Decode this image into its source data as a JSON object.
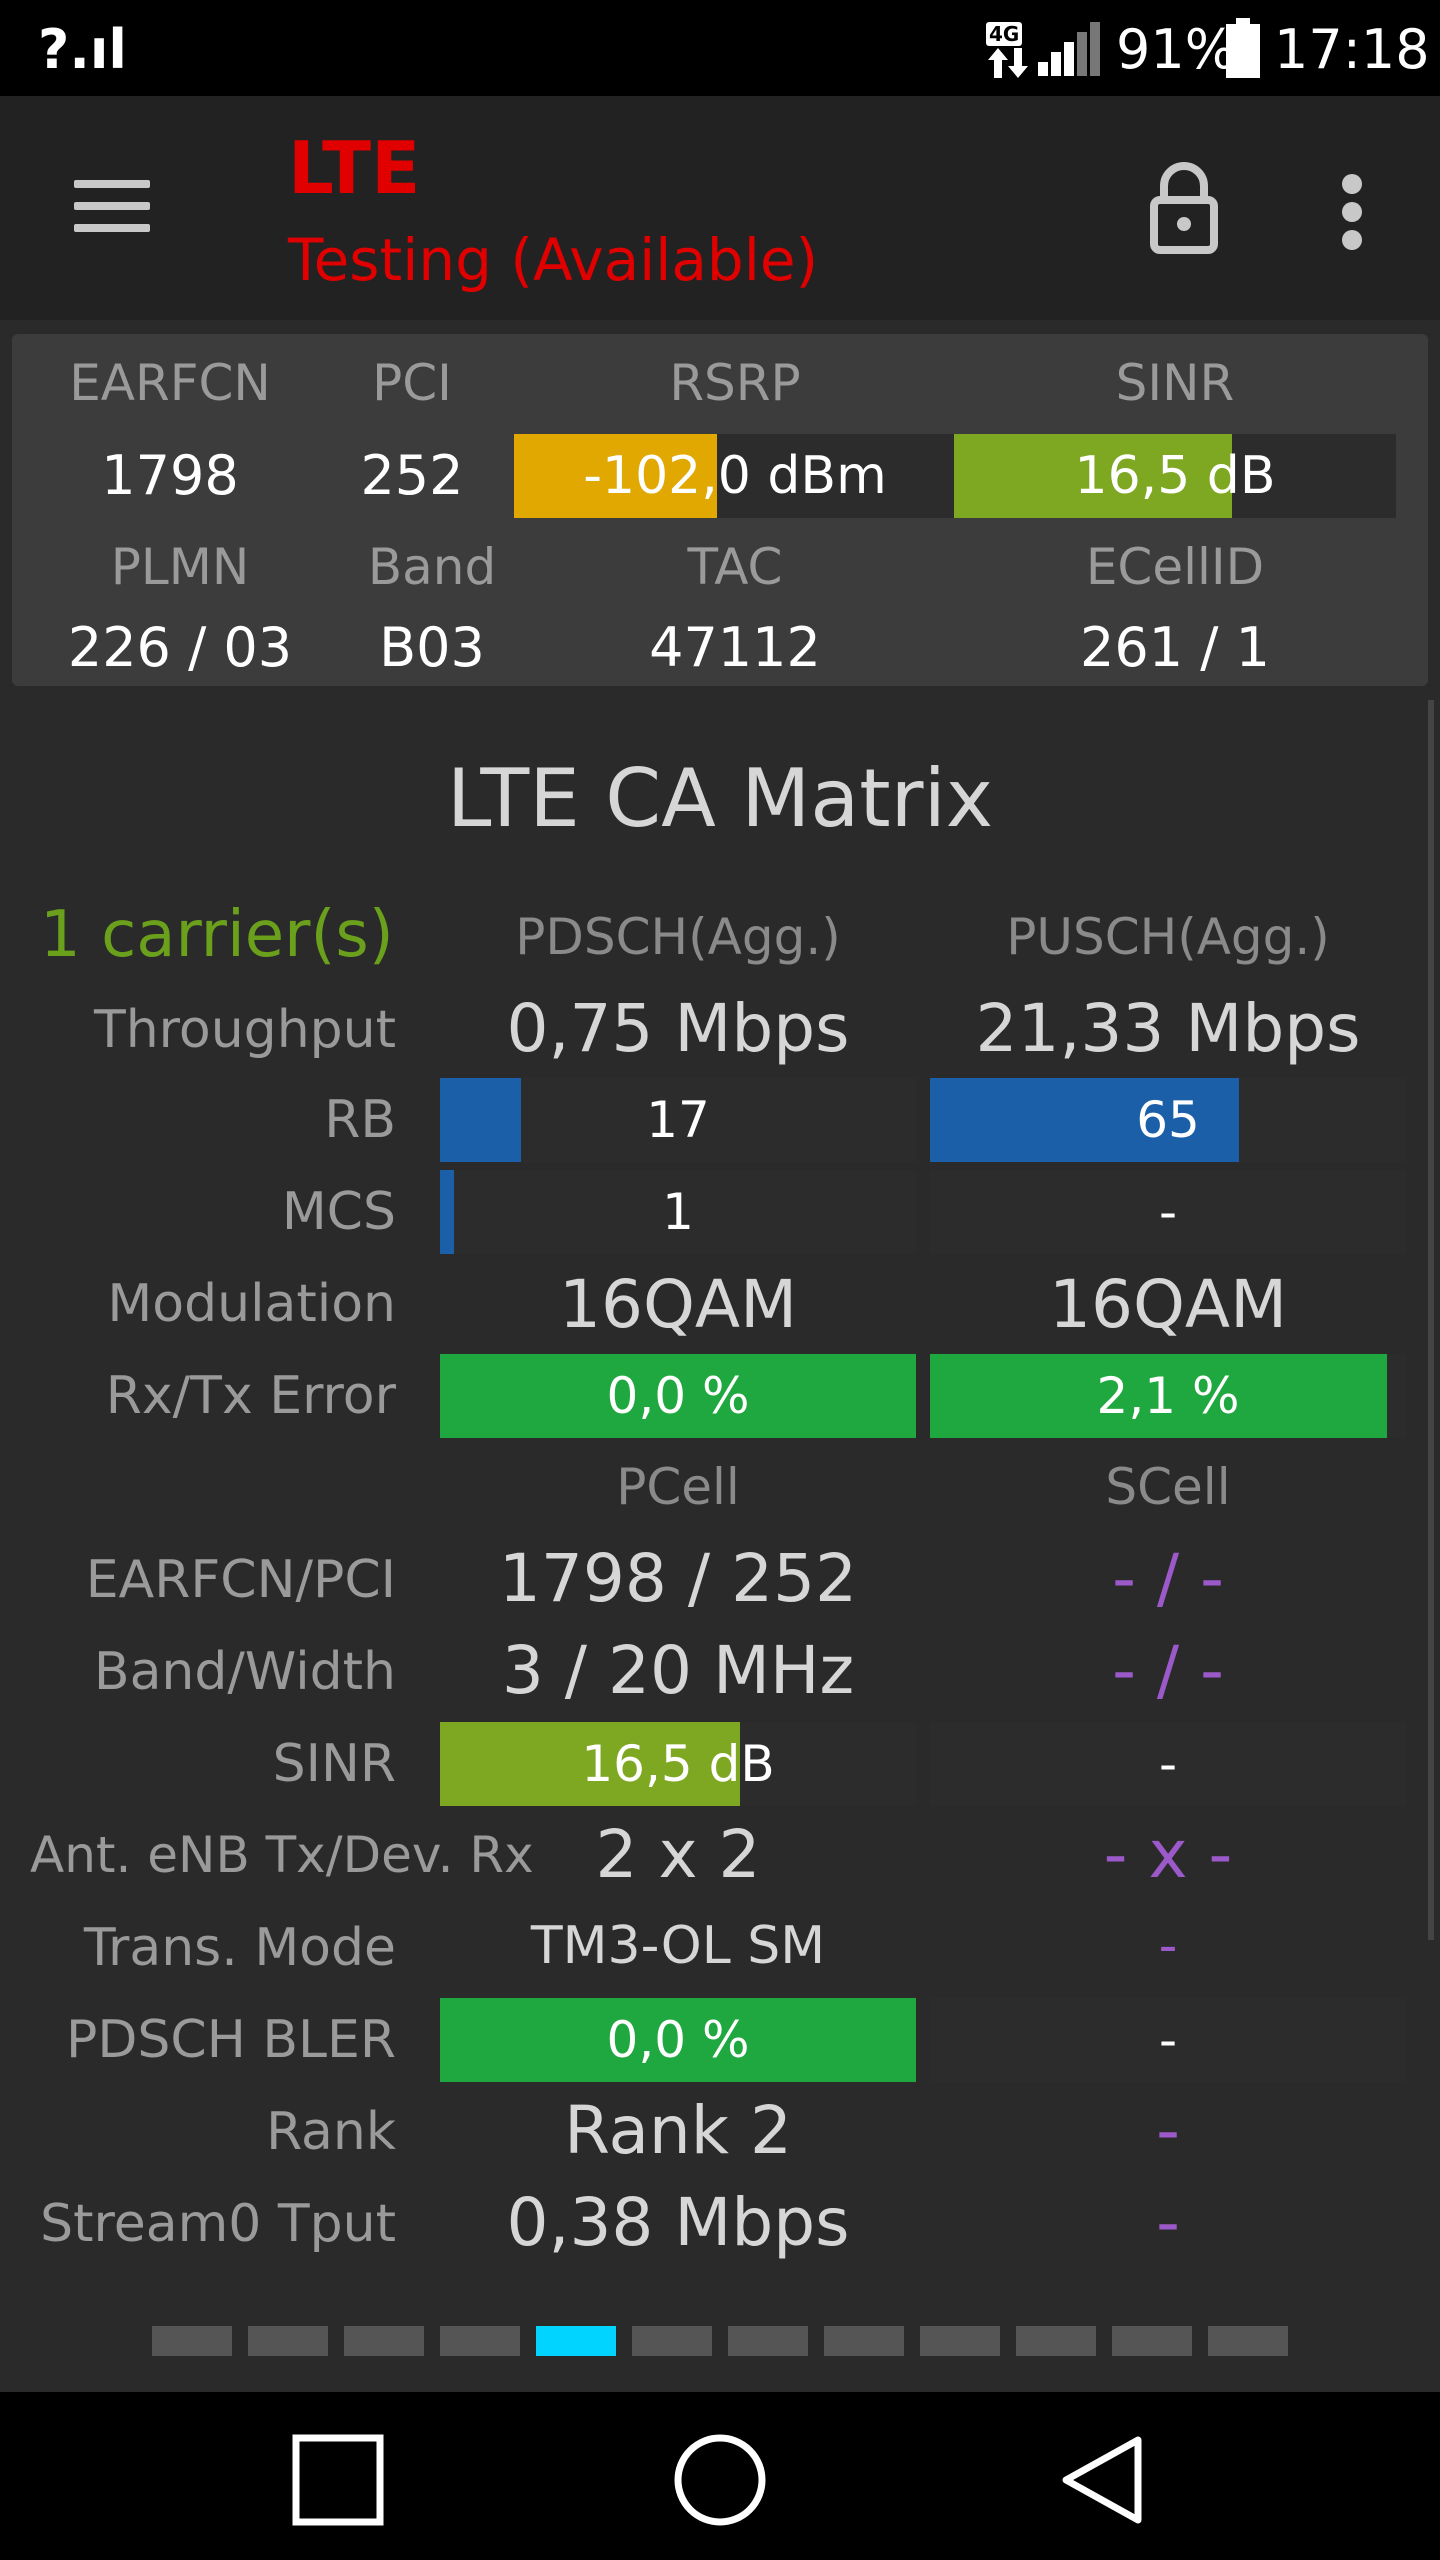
{
  "status_bar": {
    "signal_text": "?.ıl",
    "network_badge": "4G",
    "battery_percent": "91%",
    "time": "17:18",
    "icons": [
      "signal-unknown-icon",
      "data-transfer-icon",
      "cell-signal-icon",
      "battery-icon"
    ]
  },
  "app_bar": {
    "title": "LTE",
    "subtitle": "Testing (Available)",
    "title_color": "#e00000",
    "icons": [
      "hamburger-menu-icon",
      "lock-icon",
      "overflow-menu-icon"
    ]
  },
  "summary": {
    "labels": {
      "earfcn": "EARFCN",
      "pci": "PCI",
      "rsrp": "RSRP",
      "sinr": "SINR",
      "plmn": "PLMN",
      "band": "Band",
      "tac": "TAC",
      "ecellid": "ECellID"
    },
    "values": {
      "earfcn": "1798",
      "pci": "252",
      "rsrp": "-102,0 dBm",
      "sinr": "16,5 dB",
      "plmn": "226 / 03",
      "band": "B03",
      "tac": "47112",
      "ecellid": "261 / 1"
    },
    "rsrp_level": 0.46,
    "sinr_level": 0.63,
    "rsrp_color": "#e0a800",
    "sinr_color": "#7fa822"
  },
  "ca": {
    "title": "LTE CA Matrix",
    "carriers": "1 carrier(s)",
    "carriers_color": "#6aa01c",
    "headers": {
      "pdsch": "PDSCH(Agg.)",
      "pusch": "PUSCH(Agg.)",
      "pcell": "PCell",
      "scell": "SCell"
    },
    "labels": {
      "throughput": "Throughput",
      "rb": "RB",
      "mcs": "MCS",
      "modulation": "Modulation",
      "rxtx_error": "Rx/Tx Error",
      "earfcn_pci": "EARFCN/PCI",
      "band_width": "Band/Width",
      "sinr": "SINR",
      "ant": "Ant. eNB Tx/Dev. Rx",
      "trans_mode": "Trans. Mode",
      "pdsch_bler": "PDSCH BLER",
      "rank": "Rank",
      "stream0": "Stream0 Tput"
    },
    "pdsch": {
      "throughput": "0,75 Mbps",
      "rb": "17",
      "mcs": "1",
      "modulation": "16QAM",
      "error": "0,0 %"
    },
    "pusch": {
      "throughput": "21,33 Mbps",
      "rb": "65",
      "mcs": "-",
      "modulation": "16QAM",
      "error": "2,1 %"
    },
    "pdsch_rb_level": 0.17,
    "pusch_rb_level": 0.65,
    "pdsch_mcs_level": 0.03,
    "pdsch_error_level": 1.0,
    "pusch_error_level": 0.96,
    "pcell": {
      "earfcn_pci": "1798 / 252",
      "band_width": "3 / 20 MHz",
      "sinr": "16,5 dB",
      "ant": "2 x 2",
      "trans_mode": "TM3-OL SM",
      "pdsch_bler": "0,0 %",
      "rank": "Rank 2",
      "stream0": "0,38 Mbps"
    },
    "scell": {
      "earfcn_pci": "- / -",
      "band_width": "- / -",
      "sinr": "-",
      "ant": "- x -",
      "trans_mode": "-",
      "pdsch_bler": "-",
      "rank": "-",
      "stream0": "-"
    },
    "pcell_sinr_level": 0.63,
    "pcell_bler_level": 1.0,
    "rb_color": "#1a5fa8",
    "ok_color": "#20a840",
    "sinr_color": "#7fa822",
    "scell_color": "#9b59c9"
  },
  "pager": {
    "count": 12,
    "active_index": 4,
    "active_color": "#00d4ff"
  },
  "nav_bar": {
    "icons": [
      "recents-square-icon",
      "home-circle-icon",
      "back-triangle-icon"
    ]
  }
}
